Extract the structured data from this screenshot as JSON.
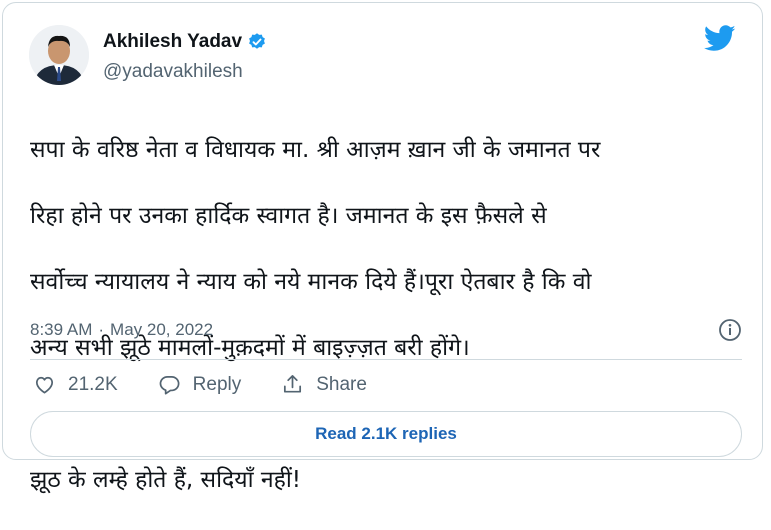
{
  "author": {
    "name": "Akhilesh Yadav",
    "handle": "@yadavakhilesh",
    "verified": true
  },
  "tweet": {
    "lines": [
      "सपा के वरिष्ठ नेता व विधायक मा. श्री आज़म ख़ान जी के जमानत पर",
      "रिहा होने पर उनका हार्दिक स्वागत है। जमानत के इस फ़ैसले से",
      "सर्वोच्च न्यायालय ने न्याय को नये मानक दिये हैं।पूरा ऐतबार है कि वो",
      "अन्य सभी झूठे मामलों-मुक़दमों में बाइज़्ज़त बरी होंगे।",
      "",
      "झूठ के लम्हे होते हैं, सदियाँ नहीं!"
    ],
    "time": "8:39 AM",
    "separator": "·",
    "date": "May 20, 2022"
  },
  "actions": {
    "like_count": "21.2K",
    "reply_label": "Reply",
    "share_label": "Share"
  },
  "replies_button_label": "Read 2.1K replies",
  "colors": {
    "accent": "#1d9bf0",
    "link": "#1d65b5",
    "secondary_text": "#536471",
    "border": "#cfd9de"
  },
  "icons": {
    "brand": "twitter-bird-icon",
    "verified": "verified-badge-icon",
    "info": "info-icon",
    "like": "heart-icon",
    "reply": "speech-bubble-icon",
    "share": "share-upload-icon"
  }
}
